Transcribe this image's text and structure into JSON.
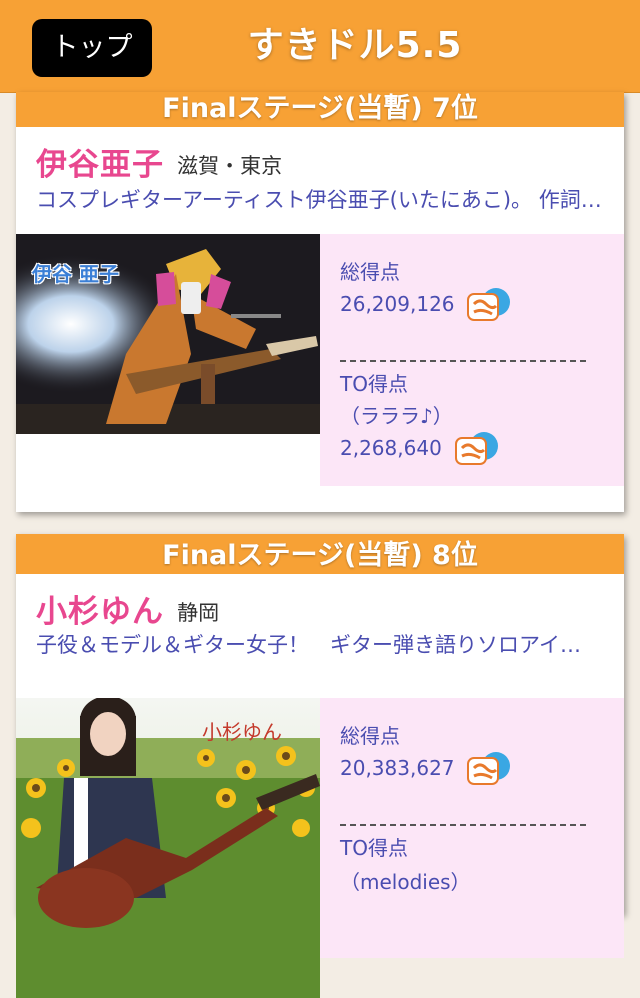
{
  "header": {
    "top_button": "トップ",
    "app_title": "すきドル5.5"
  },
  "cards": [
    {
      "rank_text": "Finalステージ(当暫) 7位",
      "name": "伊谷亜子",
      "area": "滋賀・東京",
      "description": "コスプレギターアーティスト伊谷亜子(いたにあこ)。 作詞…",
      "photo_caption": "伊谷 亜子",
      "total_label": "総得点",
      "total_score": "26,209,126",
      "to_label": "TO得点",
      "to_name": "（ラララ♪）",
      "to_score": "2,268,640"
    },
    {
      "rank_text": "Finalステージ(当暫) 8位",
      "name": "小杉ゆん",
      "area": "静岡",
      "description": "子役＆モデル＆ギター女子！　ギター弾き語りソロアイ…",
      "photo_caption": "小杉ゆん",
      "total_label": "総得点",
      "total_score": "20,383,627",
      "to_label": "TO得点",
      "to_name": "（melodies）"
    }
  ],
  "icons": {
    "score_badge": "suki-badge-icon"
  },
  "colors": {
    "accent": "#f7a135",
    "name_pink": "#e8478f",
    "text_blue": "#4a4db0",
    "panel_pink": "#fce6f7"
  }
}
